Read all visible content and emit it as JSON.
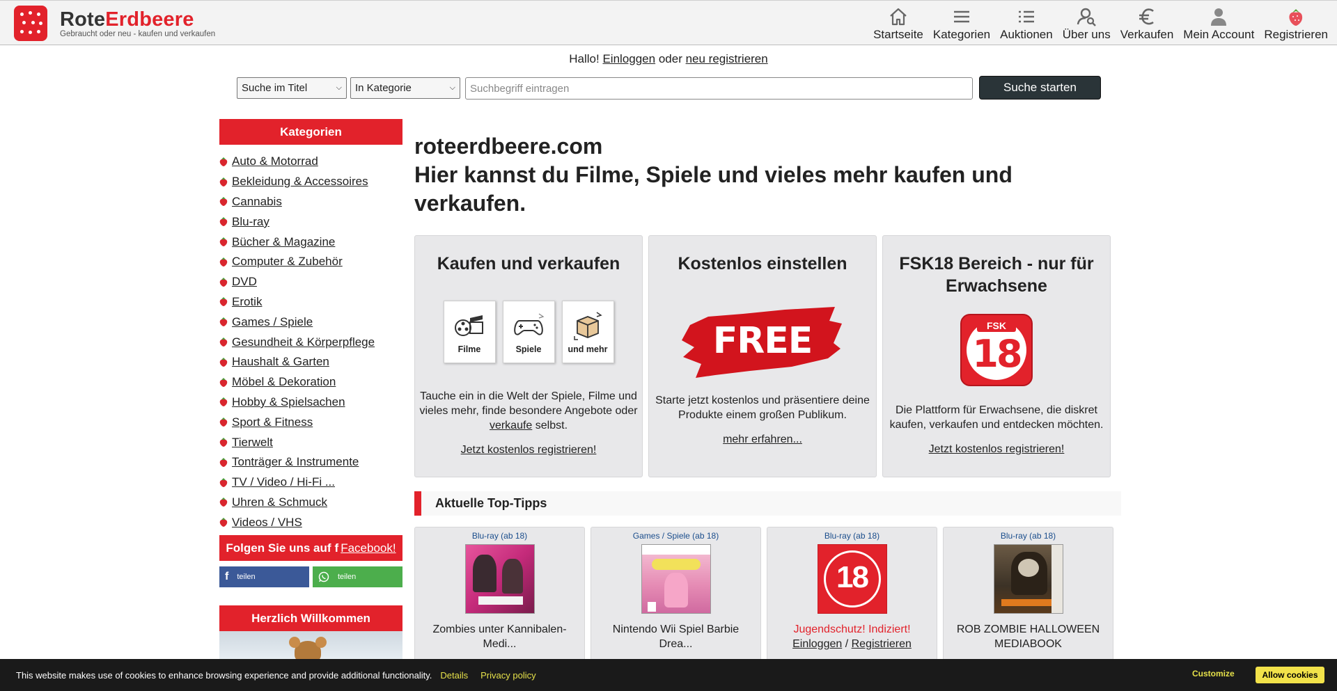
{
  "header": {
    "brand_part1": "Rote",
    "brand_part2": "Erdbeere",
    "tagline": "Gebraucht oder neu - kaufen und verkaufen",
    "nav": [
      {
        "label": "Startseite",
        "icon": "home-icon"
      },
      {
        "label": "Kategorien",
        "icon": "menu-icon"
      },
      {
        "label": "Auktionen",
        "icon": "list-icon"
      },
      {
        "label": "Über uns",
        "icon": "user-search-icon"
      },
      {
        "label": "Verkaufen",
        "icon": "euro-icon"
      },
      {
        "label": "Mein Account",
        "icon": "account-icon"
      },
      {
        "label": "Registrieren",
        "icon": "strawberry-icon"
      }
    ]
  },
  "greeting": {
    "hello": "Hallo!",
    "login": "Einloggen",
    "or": "oder",
    "register": "neu registrieren"
  },
  "search": {
    "scope_selected": "Suche im Titel",
    "category_selected": "In Kategorie",
    "placeholder": "Suchbegriff eintragen",
    "button": "Suche starten"
  },
  "sidebar": {
    "heading": "Kategorien",
    "categories": [
      "Auto & Motorrad",
      "Bekleidung & Accessoires",
      "Cannabis",
      "Blu-ray",
      "Bücher & Magazine",
      "Computer & Zubehör",
      "DVD",
      "Erotik",
      "Games / Spiele",
      "Gesundheit & Körperpflege",
      "Haushalt & Garten",
      "Möbel & Dekoration",
      "Hobby & Spielsachen",
      "Sport & Fitness",
      "Tierwelt",
      "Tonträger & Instrumente",
      "TV / Video / Hi-Fi ...",
      "Uhren & Schmuck",
      "Videos / VHS"
    ],
    "follow_text": "Folgen Sie uns auf",
    "follow_link": "Facebook!",
    "share_fb": "teilen",
    "share_wa": "teilen",
    "welcome": "Herzlich Willkommen"
  },
  "main": {
    "title_line1": "roteerdbeere.com",
    "title_line2": "Hier kannst du Filme, Spiele und vieles mehr kaufen und verkaufen.",
    "cards": [
      {
        "title": "Kaufen und verkaufen",
        "tiles": [
          "Filme",
          "Spiele",
          "und mehr"
        ],
        "text_before": "Tauche ein in die Welt der Spiele, Filme und vieles mehr, finde besondere Angebote oder",
        "text_link": "verkaufe",
        "text_after": "selbst.",
        "link": "Jetzt kostenlos registrieren!"
      },
      {
        "title": "Kostenlos einstellen",
        "badge": "FREE",
        "text": "Starte jetzt kostenlos und präsentiere deine Produkte einem großen Publikum.",
        "link": "mehr erfahren..."
      },
      {
        "title": "FSK18 Bereich - nur für Erwachsene",
        "badge_top": "FSK",
        "badge_num": "18",
        "text": "Die Plattform für Erwachsene, die diskret kaufen, verkaufen und entdecken möchten.",
        "link": "Jetzt kostenlos registrieren!"
      }
    ]
  },
  "tips": {
    "heading": "Aktuelle Top-Tipps",
    "products": [
      {
        "category": "Blu-ray (ab 18)",
        "title": "Zombies unter Kannibalen-Medi..."
      },
      {
        "category": "Games / Spiele (ab 18)",
        "title": "Nintendo Wii Spiel Barbie Drea..."
      },
      {
        "category": "Blu-ray (ab 18)",
        "warning": "Jugendschutz! Indiziert!",
        "login": "Einloggen",
        "sep": "/",
        "register": "Registrieren",
        "badge_num": "18"
      },
      {
        "category": "Blu-ray (ab 18)",
        "title": "ROB ZOMBIE HALLOWEEN MEDIABOOK"
      }
    ]
  },
  "cookie": {
    "text": "This website makes use of cookies to enhance browsing experience and provide additional functionality.",
    "details": "Details",
    "privacy": "Privacy policy",
    "customize": "Customize",
    "allow": "Allow cookies"
  },
  "colors": {
    "brand_red": "#e2222b",
    "search_button": "#2a3438",
    "facebook": "#3b5998",
    "whatsapp": "#4cae4c",
    "cookie_accent": "#e6e14a"
  }
}
